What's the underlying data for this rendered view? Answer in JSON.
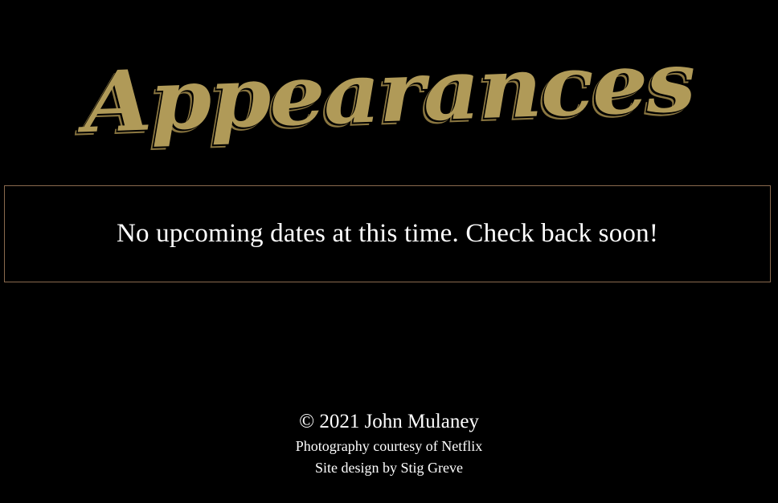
{
  "header": {
    "title": "Appearances"
  },
  "main": {
    "notice": "No upcoming dates at this time. Check back soon!"
  },
  "footer": {
    "copyright": "© 2021 John Mulaney",
    "photo_credit": "Photography courtesy of Netflix",
    "design_credit": "Site design by Stig Greve"
  },
  "colors": {
    "background": "#000000",
    "title_gold": "#b09a58",
    "box_border": "#8a6a4e",
    "text": "#ffffff"
  }
}
